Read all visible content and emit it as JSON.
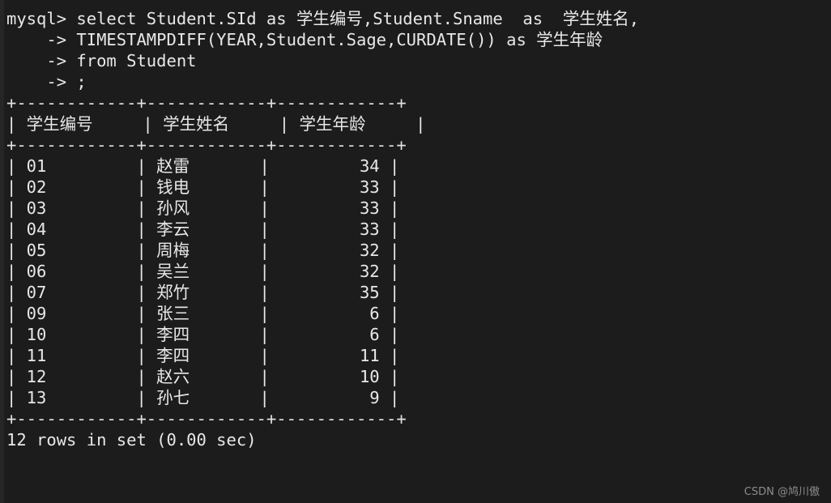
{
  "terminal": {
    "background_color": "#1c1c1c",
    "text_color": "#e8e8e8",
    "prompt": "mysql>",
    "continuation_prompt": "->"
  },
  "query": {
    "lines": [
      "mysql> select Student.SId as 学生编号,Student.Sname  as  学生姓名,",
      "    -> TIMESTAMPDIFF(YEAR,Student.Sage,CURDATE()) as 学生年龄",
      "    -> from Student",
      "    -> ;"
    ]
  },
  "result_table": {
    "border_top": "+------------+------------+------------+",
    "border_mid": "+------------+------------+------------+",
    "border_bottom": "+------------+------------+------------+",
    "header_row": "| 学生编号     | 学生姓名     | 学生年龄     |",
    "columns": [
      "学生编号",
      "学生姓名",
      "学生年龄"
    ],
    "rows": [
      {
        "line": "| 01         | 赵雷       |         34 |",
        "sid": "01",
        "sname": "赵雷",
        "sage": "34"
      },
      {
        "line": "| 02         | 钱电       |         33 |",
        "sid": "02",
        "sname": "钱电",
        "sage": "33"
      },
      {
        "line": "| 03         | 孙风       |         33 |",
        "sid": "03",
        "sname": "孙风",
        "sage": "33"
      },
      {
        "line": "| 04         | 李云       |         33 |",
        "sid": "04",
        "sname": "李云",
        "sage": "33"
      },
      {
        "line": "| 05         | 周梅       |         32 |",
        "sid": "05",
        "sname": "周梅",
        "sage": "32"
      },
      {
        "line": "| 06         | 吴兰       |         32 |",
        "sid": "06",
        "sname": "吴兰",
        "sage": "32"
      },
      {
        "line": "| 07         | 郑竹       |         35 |",
        "sid": "07",
        "sname": "郑竹",
        "sage": "35"
      },
      {
        "line": "| 09         | 张三       |          6 |",
        "sid": "09",
        "sname": "张三",
        "sage": "6"
      },
      {
        "line": "| 10         | 李四       |          6 |",
        "sid": "10",
        "sname": "李四",
        "sage": "6"
      },
      {
        "line": "| 11         | 李四       |         11 |",
        "sid": "11",
        "sname": "李四",
        "sage": "11"
      },
      {
        "line": "| 12         | 赵六       |         10 |",
        "sid": "12",
        "sname": "赵六",
        "sage": "10"
      },
      {
        "line": "| 13         | 孙七       |          9 |",
        "sid": "13",
        "sname": "孙七",
        "sage": "9"
      }
    ]
  },
  "status": {
    "text": "12 rows in set (0.00 sec)",
    "row_count": 12,
    "duration": "0.00 sec"
  },
  "watermark": {
    "text": "CSDN @鸠川傲"
  }
}
